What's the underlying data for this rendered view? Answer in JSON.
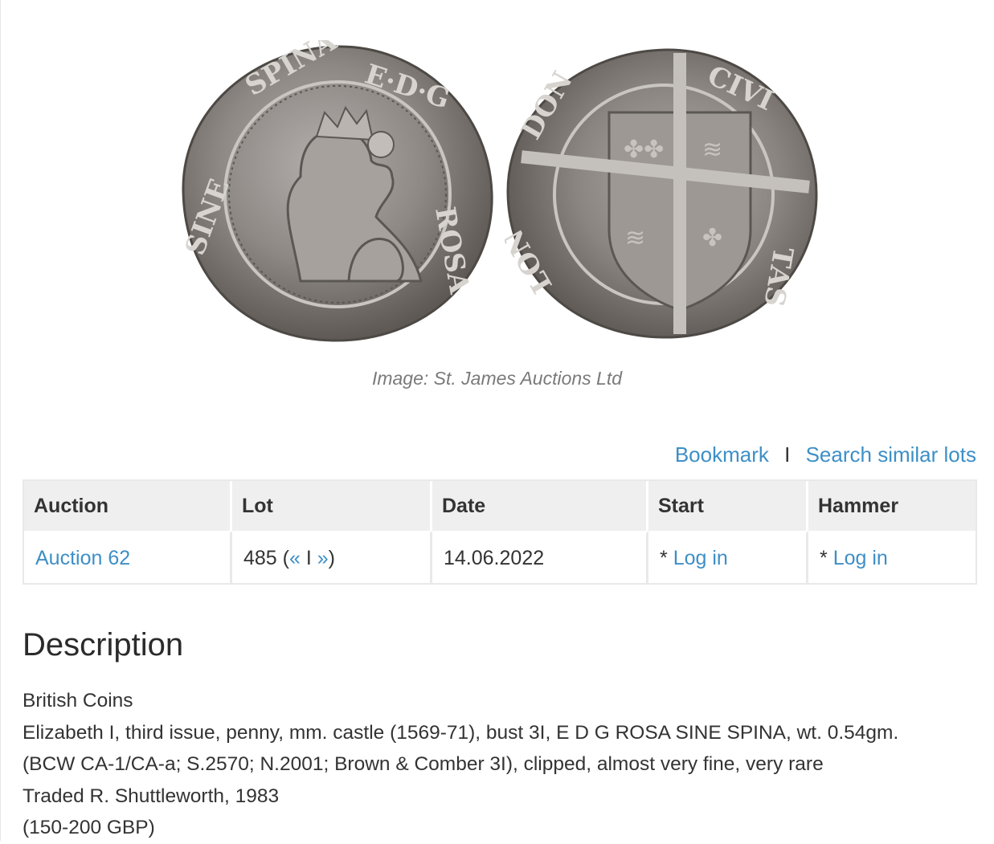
{
  "image": {
    "obverse_icon": "coin-obverse-icon",
    "reverse_icon": "coin-reverse-icon",
    "caption": "Image: St. James Auctions Ltd"
  },
  "actions": {
    "bookmark": "Bookmark",
    "separator": "I",
    "search_similar": "Search similar lots"
  },
  "table": {
    "headers": {
      "auction": "Auction",
      "lot": "Lot",
      "date": "Date",
      "start": "Start",
      "hammer": "Hammer"
    },
    "row": {
      "auction": "Auction 62",
      "lot_number": "485 (",
      "prev": "«",
      "lot_sep": " I ",
      "next": "»",
      "lot_close": ")",
      "date": "14.06.2022",
      "start_prefix": "* ",
      "start_link": "Log in",
      "hammer_prefix": "* ",
      "hammer_link": "Log in"
    }
  },
  "description": {
    "heading": "Description",
    "lines": [
      "British Coins",
      "Elizabeth I, third issue, penny, mm. castle (1569-71), bust 3I, E D G ROSA SINE SPINA, wt. 0.54gm.",
      "(BCW CA-1/CA-a; S.2570; N.2001; Brown & Comber 3I), clipped, almost very fine, very rare",
      "Traded R. Shuttleworth, 1983",
      "(150-200 GBP)"
    ]
  },
  "colors": {
    "link": "#3d8fc7",
    "header_bg": "#efefef",
    "caption": "#7a7a7a",
    "coin_silver": "#8f8b88"
  }
}
